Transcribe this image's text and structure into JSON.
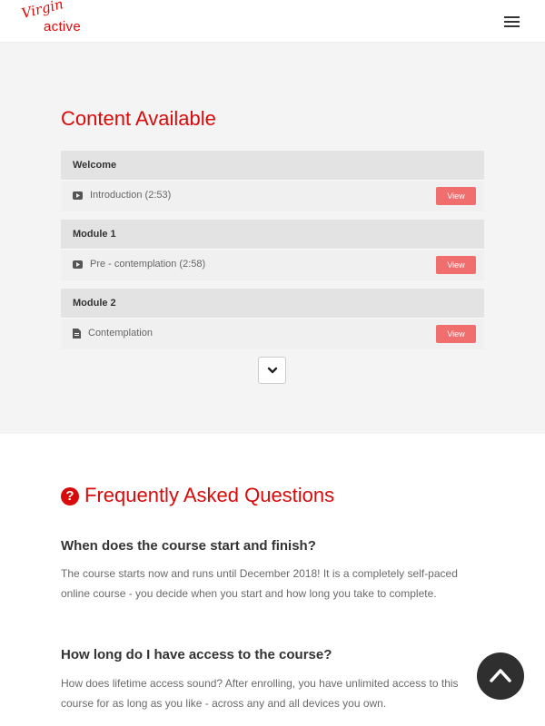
{
  "header": {
    "logo_script": "Virgin",
    "logo_word": "active",
    "brand_color": "#e10a0a"
  },
  "content": {
    "title": "Content Available",
    "modules": [
      {
        "name": "Welcome",
        "lesson": {
          "title": "Introduction (2:53)",
          "icon": "play-icon",
          "button": "View"
        }
      },
      {
        "name": "Module 1",
        "lesson": {
          "title": "Pre - contemplation (2:58)",
          "icon": "play-icon",
          "button": "View"
        }
      },
      {
        "name": "Module 2",
        "lesson": {
          "title": "Contemplation",
          "icon": "document-icon",
          "button": "View"
        }
      }
    ]
  },
  "faq": {
    "title": "Frequently Asked Questions",
    "items": [
      {
        "question": "When does the course start and finish?",
        "answer": "The course starts now and runs until December 2018! It is a completely self-paced online course - you decide when you start and how long you take to complete."
      },
      {
        "question": "How long do I have access to the course?",
        "answer": "How does lifetime access sound? After enrolling, you have unlimited access to this course for as long as you like - across any and all devices you own."
      }
    ]
  },
  "colors": {
    "accent": "#d80b0b",
    "button": "#f06e6e",
    "panel": "#f4f4f4"
  }
}
